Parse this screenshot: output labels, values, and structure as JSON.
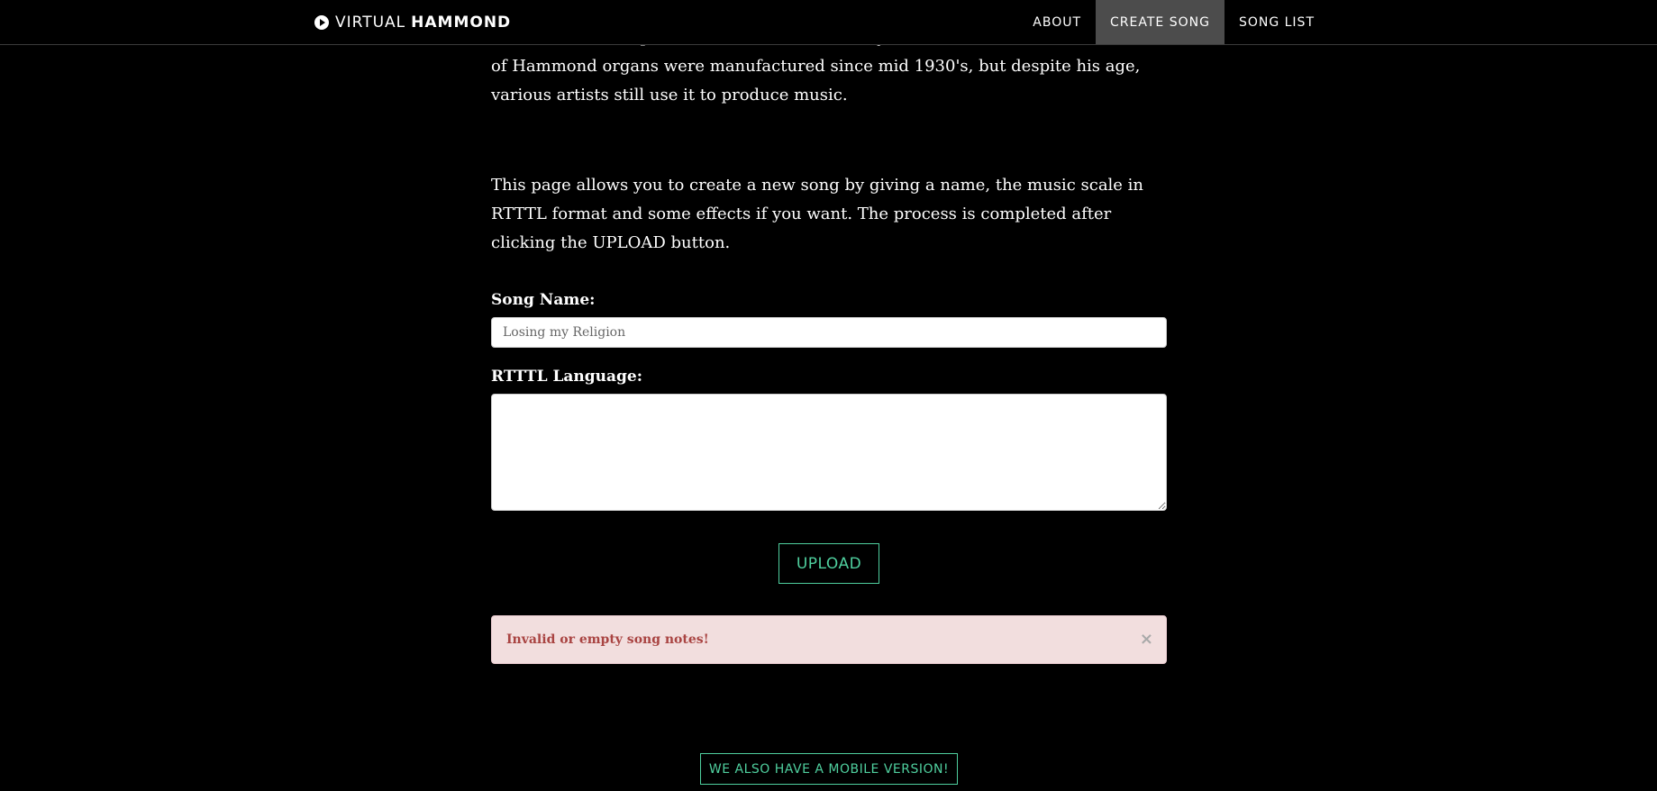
{
  "navbar": {
    "brand_light": "VIRTUAL",
    "brand_bold": "HAMMOND",
    "brand_icon": "play-circle-icon",
    "links": [
      {
        "label": "ABOUT",
        "active": false
      },
      {
        "label": "CREATE SONG",
        "active": true
      },
      {
        "label": "SONG LIST",
        "active": false
      }
    ]
  },
  "content": {
    "paragraph_1": "and was a crucial point for his success. Actually, it's estimated that a few million of Hammond organs were manufactured since mid 1930's, but despite his age, various artists still use it to produce music.",
    "paragraph_2": "This page allows you to create a new song by giving a name, the music scale in RTTTL format and some effects if you want. The process is completed after clicking the UPLOAD button."
  },
  "form": {
    "song_name_label": "Song Name:",
    "song_name_placeholder": "Losing my Religion",
    "song_name_value": "",
    "rtttl_label": "RTTTL Language:",
    "rtttl_value": "",
    "upload_label": "UPLOAD"
  },
  "alert": {
    "message": "Invalid or empty song notes!",
    "close_symbol": "×"
  },
  "footer": {
    "mobile_label": "WE ALSO HAVE A MOBILE VERSION!"
  },
  "colors": {
    "background": "#000000",
    "accent": "#4fcf9e",
    "nav_active": "#4c4c4c",
    "alert_bg": "#f2dede",
    "alert_text": "#a94442"
  }
}
